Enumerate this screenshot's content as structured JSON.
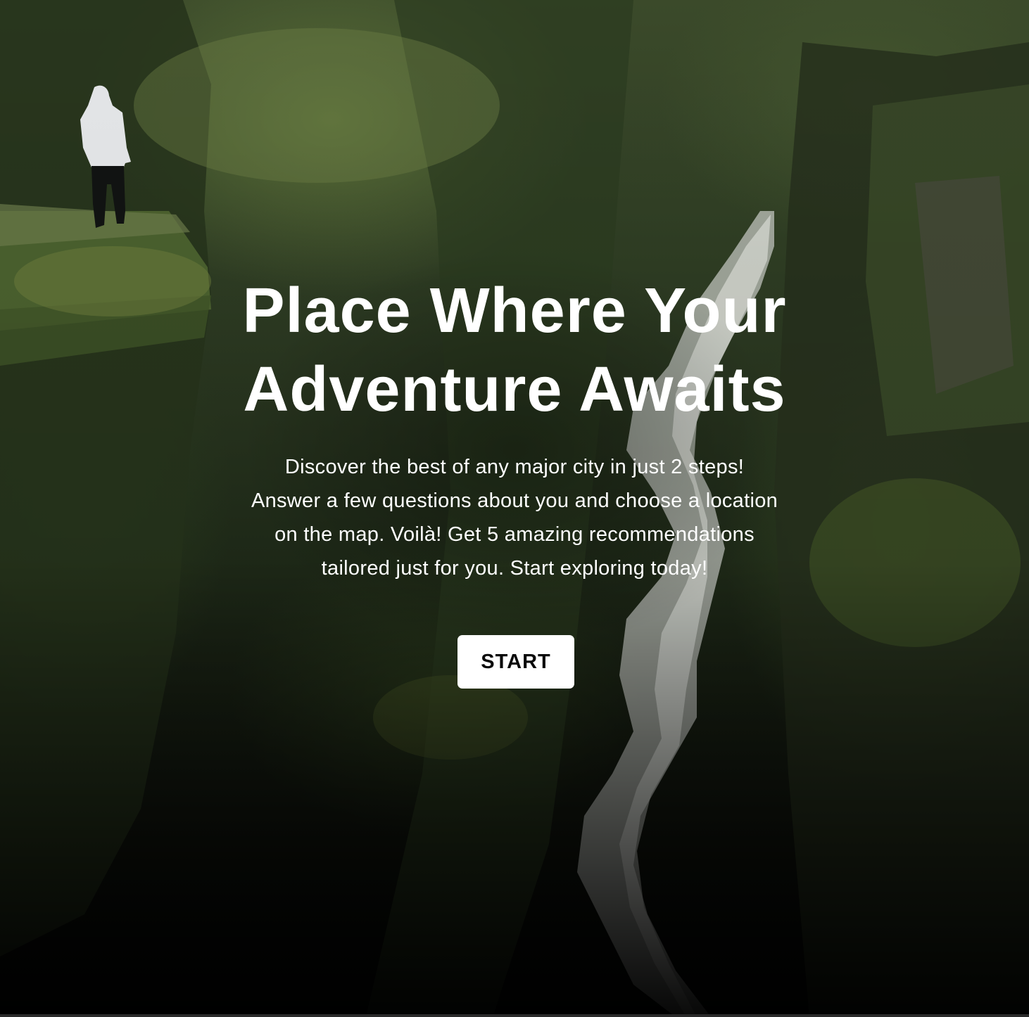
{
  "hero": {
    "title_lines": [
      "Place Where Your",
      "Adventure Awaits"
    ],
    "description_lines": [
      "Discover the best of any major city in just 2 steps!",
      "Answer a few questions about you and choose a location",
      "on the map. Voilà! Get 5 amazing recommendations",
      "tailored just for you. Start exploring today!"
    ],
    "start_label": "START"
  },
  "colors": {
    "text": "#ffffff",
    "button_background": "#ffffff",
    "button_text": "#0a0a0a",
    "moss_green": "#4a5d2c"
  }
}
